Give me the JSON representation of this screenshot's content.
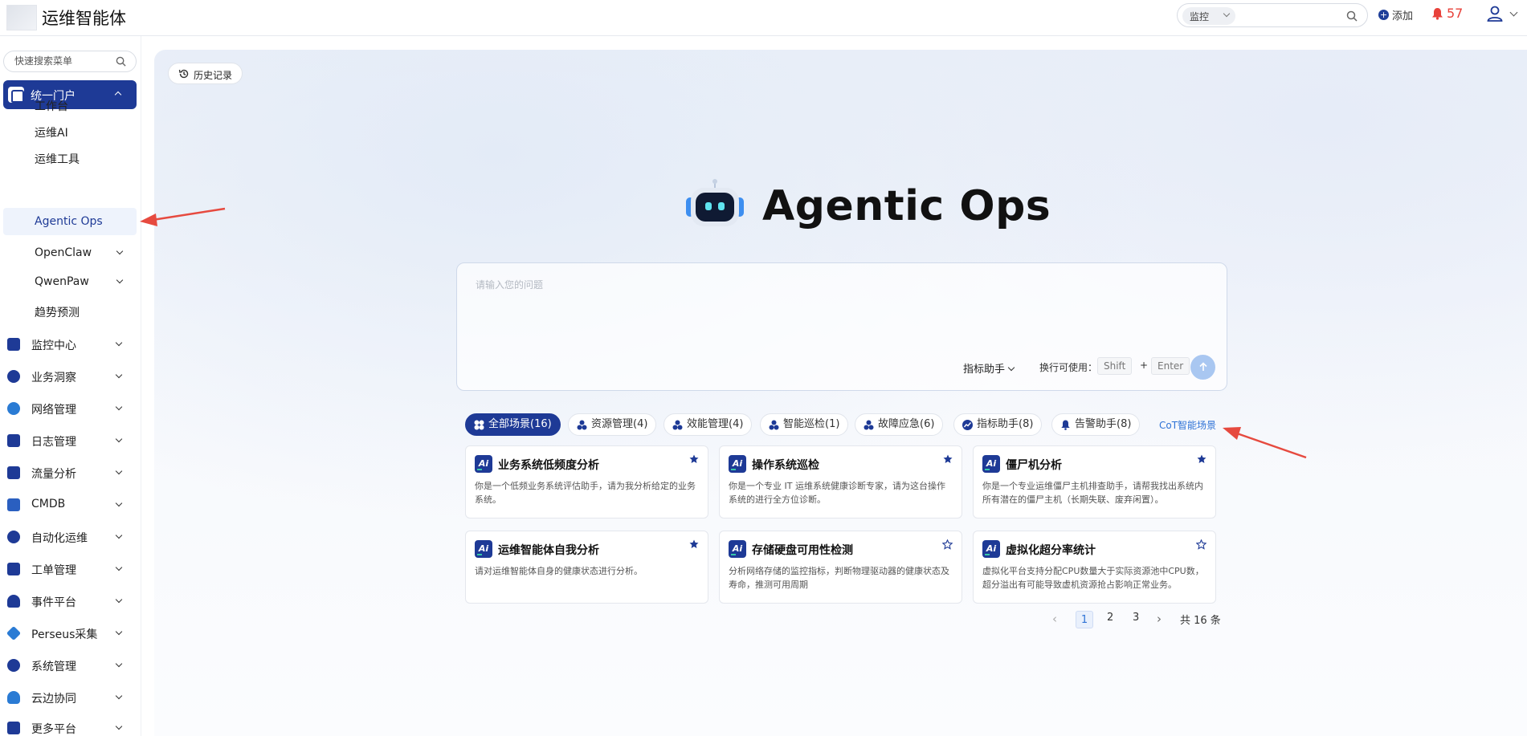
{
  "header": {
    "app_title": "运维智能体",
    "search_scope": "监控",
    "add_label": "添加",
    "alert_count": "57",
    "icons": [
      "search-icon",
      "plus-icon",
      "bell-icon",
      "user-icon",
      "chevron-down-icon"
    ]
  },
  "sidebar": {
    "search_placeholder": "快速搜索菜单",
    "portal": {
      "label": "统一门户"
    },
    "sub_items": [
      {
        "label": "工作台"
      },
      {
        "label": "运维AI"
      },
      {
        "label": "运维工具"
      },
      {
        "label": "Agentic Ops",
        "active": true
      },
      {
        "label": "OpenClaw",
        "expandable": true
      },
      {
        "label": "QwenPaw",
        "expandable": true
      },
      {
        "label": "趋势预测"
      }
    ],
    "groups": [
      {
        "label": "监控中心",
        "color": "#1e3a96"
      },
      {
        "label": "业务洞察",
        "color": "#1e3a96"
      },
      {
        "label": "网络管理",
        "color": "#2a7bd4"
      },
      {
        "label": "日志管理",
        "color": "#1e3a96"
      },
      {
        "label": "流量分析",
        "color": "#1e3a96"
      },
      {
        "label": "CMDB",
        "color": "#2a5fc0"
      },
      {
        "label": "自动化运维",
        "color": "#1e3a96"
      },
      {
        "label": "工单管理",
        "color": "#1e3a96"
      },
      {
        "label": "事件平台",
        "color": "#1e3a96"
      },
      {
        "label": "Perseus采集",
        "color": "#2a7bd4"
      },
      {
        "label": "系统管理",
        "color": "#1e3a96"
      },
      {
        "label": "云边协同",
        "color": "#2a7bd4"
      },
      {
        "label": "更多平台",
        "color": "#1e3a96"
      }
    ]
  },
  "main": {
    "history_label": "历史记录",
    "hero_title": "Agentic Ops",
    "ask": {
      "placeholder": "请输入您的问题",
      "assistant_label": "指标助手",
      "newline_hint": "换行可使用：",
      "key_shift": "Shift",
      "key_plus": "+",
      "key_enter": "Enter",
      "send_icon": "arrow-up-icon"
    },
    "tabs": [
      {
        "label": "全部场景(16)",
        "active": true
      },
      {
        "label": "资源管理(4)"
      },
      {
        "label": "效能管理(4)"
      },
      {
        "label": "智能巡检(1)"
      },
      {
        "label": "故障应急(6)"
      },
      {
        "label": "指标助手(8)"
      },
      {
        "label": "告警助手(8)"
      }
    ],
    "cot_link": "CoT智能场景",
    "cards": [
      {
        "title": "业务系统低频度分析",
        "desc": "你是一个低频业务系统评估助手，请为我分析给定的业务系统。",
        "starred": true
      },
      {
        "title": "操作系统巡检",
        "desc": "你是一个专业 IT 运维系统健康诊断专家，请为这台操作系统的进行全方位诊断。",
        "starred": true
      },
      {
        "title": "僵尸机分析",
        "desc": "你是一个专业运维僵尸主机排查助手，请帮我找出系统内所有潜在的僵尸主机（长期失联、废弃闲置）。",
        "starred": true
      },
      {
        "title": "运维智能体自我分析",
        "desc": "请对运维智能体自身的健康状态进行分析。",
        "starred": true
      },
      {
        "title": "存储硬盘可用性检测",
        "desc": "分析网络存储的监控指标，判断物理驱动器的健康状态及寿命，推测可用周期",
        "starred": false
      },
      {
        "title": "虚拟化超分率统计",
        "desc": "虚拟化平台支持分配CPU数量大于实际资源池中CPU数，超分溢出有可能导致虚机资源抢占影响正常业务。",
        "starred": false
      }
    ],
    "card_icon_text": "Ai",
    "pagination": {
      "pages": [
        "1",
        "2",
        "3"
      ],
      "current": "1",
      "total": "共 16 条"
    }
  }
}
